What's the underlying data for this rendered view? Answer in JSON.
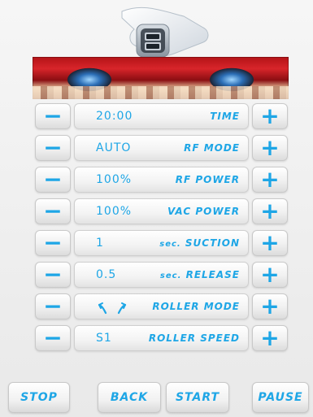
{
  "rows": [
    {
      "value": "20:00",
      "label": "TIME",
      "minus": "−",
      "plus": "+"
    },
    {
      "value": "AUTO",
      "label": "RF MODE",
      "minus": "−",
      "plus": "+"
    },
    {
      "value": "100%",
      "label": "RF POWER",
      "minus": "−",
      "plus": "+"
    },
    {
      "value": "100%",
      "label": "VAC POWER",
      "minus": "−",
      "plus": "+"
    },
    {
      "value": "1",
      "label_prefix": "sec.",
      "label": "SUCTION",
      "minus": "−",
      "plus": "+"
    },
    {
      "value": "0.5",
      "label_prefix": "sec.",
      "label": "RELEASE",
      "minus": "−",
      "plus": "+"
    },
    {
      "value_icon": "roller-arcs-icon",
      "label": "ROLLER MODE",
      "minus": "−",
      "plus": "+"
    },
    {
      "value": "S1",
      "label": "ROLLER SPEED",
      "minus": "−",
      "plus": "+"
    }
  ],
  "bottom": {
    "stop": "STOP",
    "back": "BACK",
    "start": "START",
    "pause": "PAUSE"
  },
  "colors": {
    "accent": "#1ea6e6"
  }
}
